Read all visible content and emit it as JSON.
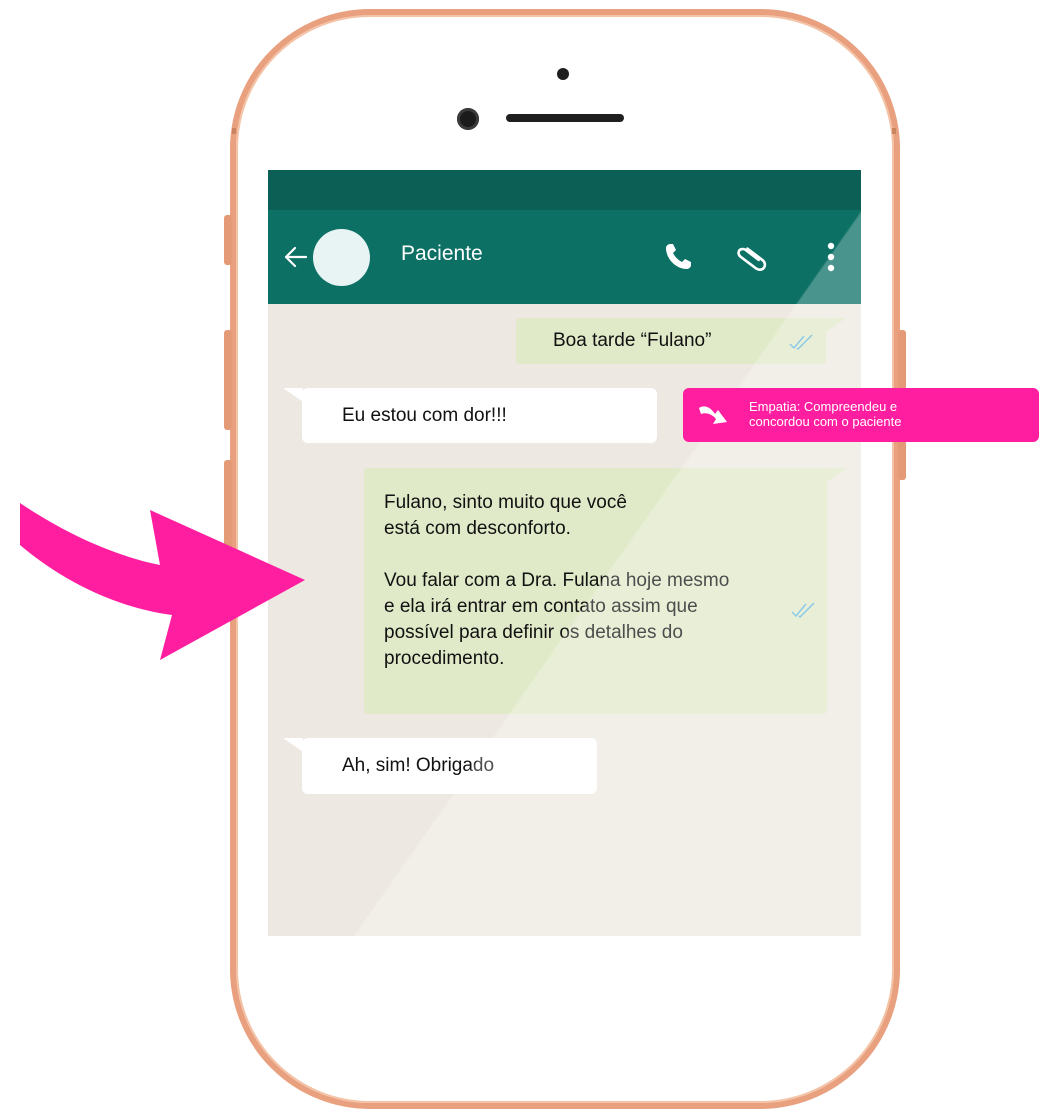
{
  "contact": {
    "name": "Paciente"
  },
  "messages": [
    {
      "direction": "outgoing",
      "text": "Boa tarde “Fulano”",
      "status": "double-check"
    },
    {
      "direction": "incoming",
      "text": "Eu estou com dor!!!"
    },
    {
      "direction": "outgoing",
      "paragraphs": [
        [
          "Fulano, sinto muito que você",
          "está com desconforto."
        ],
        [
          "Vou falar com a Dra. Fulana hoje mesmo",
          "e ela irá entrar em contato assim que",
          "possível para definir os detalhes do",
          "procedimento."
        ]
      ],
      "status": "double-check"
    },
    {
      "direction": "incoming",
      "text": "Ah, sim! Obrigado"
    }
  ],
  "annotation": {
    "line1": "Empatia: Compreendeu e",
    "line2": "concordou com o paciente",
    "color": "#ff1ea0"
  },
  "icons": {
    "header": [
      "back-arrow-icon",
      "phone-icon",
      "paperclip-icon",
      "more-vertical-icon"
    ]
  },
  "colors": {
    "header": "#0c7065",
    "status_bar": "#0c5f55",
    "outgoing_bubble": "#e0eac9",
    "incoming_bubble": "#ffffff",
    "chat_bg": "#ede8e1",
    "accent": "#ff1ea0",
    "phone_frame": "#e8a07f"
  }
}
